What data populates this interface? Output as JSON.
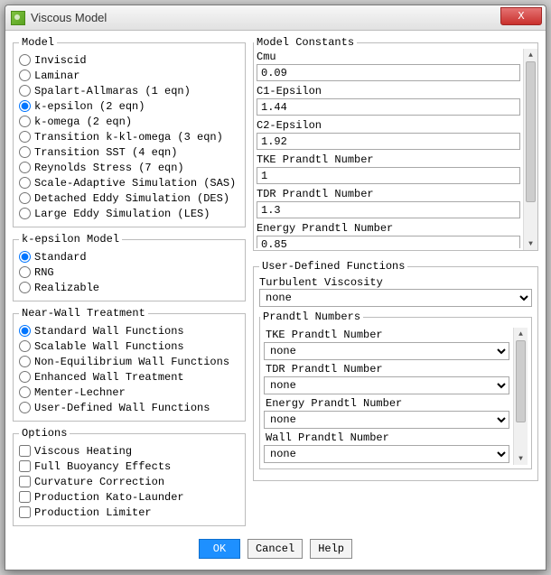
{
  "window": {
    "title": "Viscous Model",
    "close": "X"
  },
  "groups": {
    "model": "Model",
    "keps": "k-epsilon Model",
    "nwt": "Near-Wall Treatment",
    "options": "Options",
    "constants": "Model Constants",
    "udf": "User-Defined Functions",
    "prandtl": "Prandtl Numbers"
  },
  "model": {
    "inviscid": "Inviscid",
    "laminar": "Laminar",
    "spalart": "Spalart-Allmaras (1 eqn)",
    "keps": "k-epsilon (2 eqn)",
    "komega": "k-omega (2 eqn)",
    "tklo": "Transition k-kl-omega (3 eqn)",
    "tsst": "Transition SST (4 eqn)",
    "reyn": "Reynolds Stress (7 eqn)",
    "sas": "Scale-Adaptive Simulation (SAS)",
    "des": "Detached Eddy Simulation (DES)",
    "les": "Large Eddy Simulation (LES)"
  },
  "keps": {
    "std": "Standard",
    "rng": "RNG",
    "real": "Realizable"
  },
  "nwt": {
    "swf": "Standard Wall Functions",
    "scal": "Scalable Wall Functions",
    "neq": "Non-Equilibrium Wall Functions",
    "ewt": "Enhanced Wall Treatment",
    "ml": "Menter-Lechner",
    "udwf": "User-Defined Wall Functions"
  },
  "options": {
    "vh": "Viscous Heating",
    "fbe": "Full Buoyancy Effects",
    "cc": "Curvature Correction",
    "pkl": "Production Kato-Launder",
    "pl": "Production Limiter"
  },
  "constants": {
    "cmu_l": "Cmu",
    "cmu_v": "0.09",
    "c1e_l": "C1-Epsilon",
    "c1e_v": "1.44",
    "c2e_l": "C2-Epsilon",
    "c2e_v": "1.92",
    "tke_l": "TKE Prandtl Number",
    "tke_v": "1",
    "tdr_l": "TDR Prandtl Number",
    "tdr_v": "1.3",
    "en_l": "Energy Prandtl Number",
    "en_v": "0.85"
  },
  "udf": {
    "tv_l": "Turbulent Viscosity",
    "tv_v": "none",
    "tke_l": "TKE Prandtl Number",
    "tke_v": "none",
    "tdr_l": "TDR Prandtl Number",
    "tdr_v": "none",
    "en_l": "Energy Prandtl Number",
    "en_v": "none",
    "wall_l": "Wall Prandtl Number",
    "wall_v": "none"
  },
  "buttons": {
    "ok": "OK",
    "cancel": "Cancel",
    "help": "Help"
  }
}
